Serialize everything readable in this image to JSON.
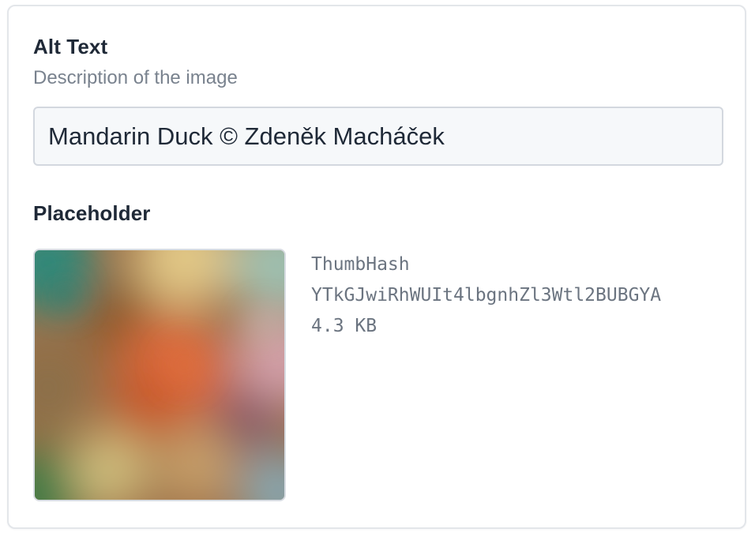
{
  "alt_text": {
    "label": "Alt Text",
    "hint": "Description of the image",
    "value": "Mandarin Duck © Zdeněk Macháček"
  },
  "placeholder": {
    "label": "Placeholder",
    "type": "ThumbHash",
    "hash": "YTkGJwiRhWUIt4lbgnhZl3Wtl2BUBGYA",
    "size": "4.3 KB"
  },
  "colors": {
    "heading": "#1f2937",
    "muted": "#79828e",
    "input_bg": "#f6f8fa",
    "input_border": "#d3d8df",
    "card_border": "#e3e6ea"
  }
}
